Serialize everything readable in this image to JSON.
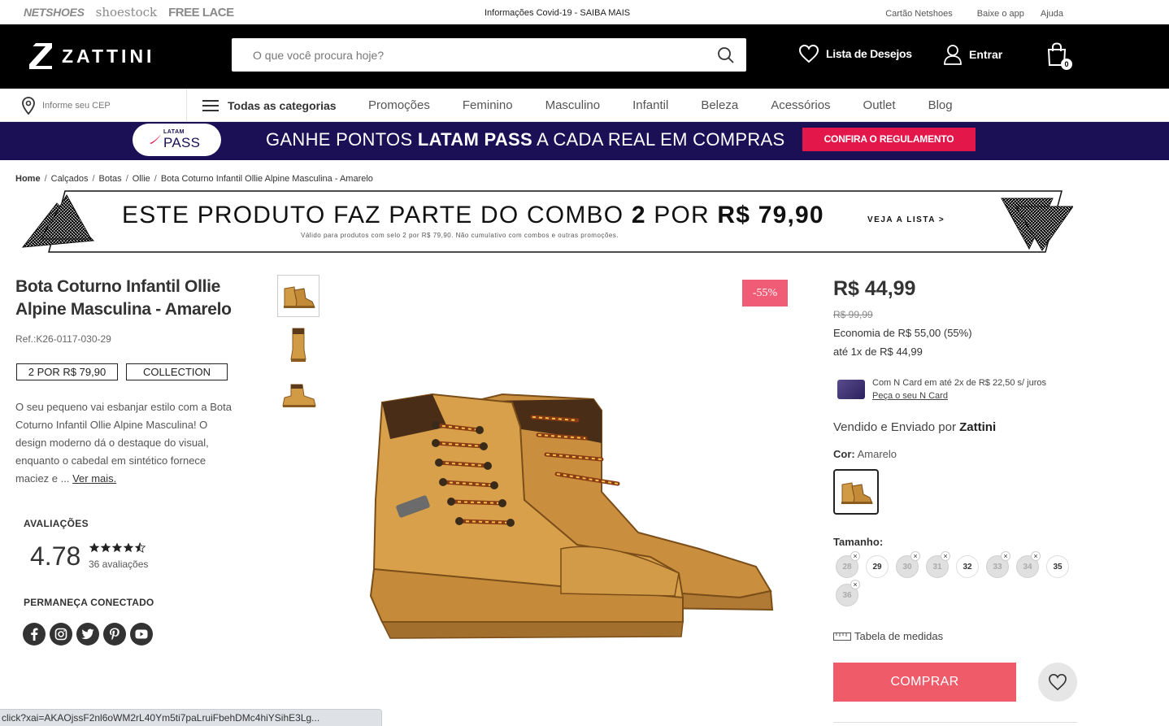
{
  "topbar": {
    "brands": [
      "NETSHOES",
      "shoestock",
      "FREE LACE"
    ],
    "covid_notice": "Informações Covid-19 - SAIBA MAIS",
    "links": [
      "Cartão Netshoes",
      "Baixe o app",
      "Ajuda"
    ]
  },
  "header": {
    "logo_text": "ZATTINI",
    "search_placeholder": "O que você procura hoje?",
    "wishlist_label": "Lista de Desejos",
    "login_label": "Entrar",
    "cart_count": "0"
  },
  "nav": {
    "cep_placeholder": "Informe seu CEP",
    "all_categories": "Todas as categorias",
    "items": [
      "Promoções",
      "Feminino",
      "Masculino",
      "Infantil",
      "Beleza",
      "Acessórios",
      "Outlet",
      "Blog"
    ]
  },
  "latam_banner": {
    "logo_top": "LATAM",
    "logo_bottom": "PASS",
    "text_before": "GANHE PONTOS ",
    "text_bold": "LATAM PASS",
    "text_after": " A CADA REAL EM COMPRAS",
    "button": "CONFIRA O REGULAMENTO"
  },
  "breadcrumb": [
    "Home",
    "Calçados",
    "Botas",
    "Ollie",
    "Bota Coturno Infantil Ollie Alpine Masculina - Amarelo"
  ],
  "combo_banner": {
    "text_before": "ESTE PRODUTO FAZ PARTE DO COMBO ",
    "text_num": "2",
    "text_mid": " POR ",
    "text_price": "R$ 79,90",
    "subtext": "Válido para produtos com selo 2 por R$ 79,90. Não cumulativo com combos e outras promoções.",
    "link": "VEJA A LISTA >"
  },
  "product": {
    "title": "Bota Coturno Infantil Ollie Alpine Masculina - Amarelo",
    "ref": "Ref.:K26-0117-030-29",
    "tags": [
      "2 POR R$ 79,90",
      "COLLECTION"
    ],
    "description": "O seu pequeno vai esbanjar estilo com a Bota Coturno Infantil Ollie Alpine Masculina! O design moderno dá o destaque do visual, enquanto o cabedal em sintético fornece maciez e ... ",
    "see_more": "Ver mais.",
    "discount_badge": "-55%"
  },
  "reviews": {
    "heading": "AVALIAÇÕES",
    "rating": "4.78",
    "stars_value": 4.78,
    "count": "36 avaliações"
  },
  "social": {
    "heading": "PERMANEÇA CONECTADO",
    "icons": [
      "facebook-icon",
      "instagram-icon",
      "twitter-icon",
      "pinterest-icon",
      "youtube-icon"
    ]
  },
  "pricing": {
    "price": "R$ 44,99",
    "old_price": "R$ 99,99",
    "economy": "Economia de R$ 55,00 (55%)",
    "installments": "até 1x de R$ 44,99",
    "ncard_text": "Com N Card em até 2x de R$ 22,50 s/ juros",
    "ncard_link": "Peça o seu N Card"
  },
  "seller": {
    "prefix": "Vendido e Enviado por ",
    "name": "Zattini"
  },
  "color": {
    "label": "Cor:",
    "value": " Amarelo"
  },
  "sizes": {
    "label": "Tamanho:",
    "items": [
      {
        "size": "28",
        "available": false
      },
      {
        "size": "29",
        "available": true
      },
      {
        "size": "30",
        "available": false
      },
      {
        "size": "31",
        "available": false
      },
      {
        "size": "32",
        "available": true
      },
      {
        "size": "33",
        "available": false
      },
      {
        "size": "34",
        "available": false
      },
      {
        "size": "35",
        "available": true
      },
      {
        "size": "36",
        "available": false
      }
    ],
    "measures_link": "Tabela de medidas"
  },
  "actions": {
    "buy": "COMPRAR"
  },
  "status_url": "click?xai=AKAOjssF2nl6oWM2rL40Ym5ti7paLruiFbehDMc4hiYSihE3Lg...",
  "colors": {
    "header_bg": "#000000",
    "latam_bg": "#1b0f56",
    "latam_button": "#e3174a",
    "discount": "#f05b75",
    "buy_button": "#f05b6a"
  }
}
